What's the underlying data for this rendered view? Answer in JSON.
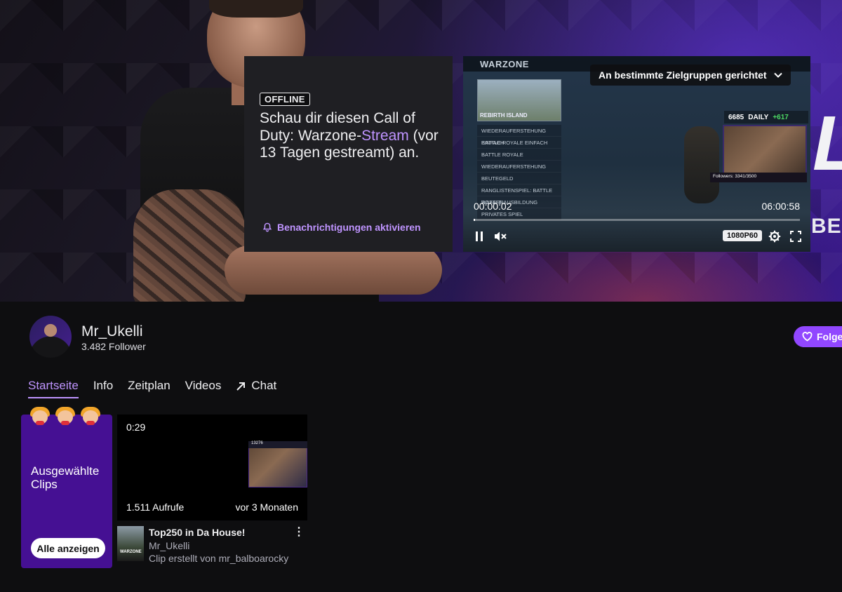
{
  "banner": {
    "offline_badge": "OFFLINE",
    "title_prefix": "Schau dir diesen Call of Duty: Warzone-",
    "title_link": "Stream",
    "title_suffix": " (vor 13 Tagen gestreamt) an.",
    "notify_label": "Benachrichtigungen aktivieren",
    "brand_letter": "L",
    "brand_text": "BE"
  },
  "player": {
    "game_logo": "WARZONE",
    "map_label": "REBIRTH ISLAND",
    "menu_items": [
      "WIEDERAUFERSTEHUNG EINFACH",
      "BATTLE ROYALE EINFACH",
      "BATTLE ROYALE",
      "WIEDERAUFERSTEHUNG",
      "BEUTEGELD",
      "RANGLISTENSPIEL: BATTLE ROYALE",
      "WAFFENAUSBILDUNG",
      "PRIVATES SPIEL"
    ],
    "hud_score": "6685",
    "hud_daily": "DAILY",
    "hud_plus": "+617",
    "cam_text": "Followers: 3341/3500",
    "audience_dropdown": "An bestimmte Zielgruppen gerichtet",
    "time_current": "00:00:02",
    "time_total": "06:00:58",
    "progress": 0.0001,
    "quality": "1080P60"
  },
  "channel": {
    "name": "Mr_Ukelli",
    "followers": "3.482 Follower",
    "follow_label": "Folgen"
  },
  "tabs": [
    {
      "label": "Startseite",
      "active": true
    },
    {
      "label": "Info",
      "active": false
    },
    {
      "label": "Zeitplan",
      "active": false
    },
    {
      "label": "Videos",
      "active": false
    },
    {
      "label": "Chat",
      "active": false
    }
  ],
  "featured": {
    "title": "Ausgewählte Clips",
    "see_all": "Alle anzeigen"
  },
  "clip": {
    "duration": "0:29",
    "views": "1.511 Aufrufe",
    "age": "vor 3 Monaten",
    "mini_hud": "13276",
    "cover_text": "WARZONE",
    "title": "Top250 in Da House!",
    "channel": "Mr_Ukelli",
    "creator": "Clip erstellt von mr_balboarocky"
  },
  "colors": {
    "accent": "#9147ff",
    "accent_text": "#bf94ff",
    "background": "#0e0e10",
    "featured_bg": "#451093"
  }
}
